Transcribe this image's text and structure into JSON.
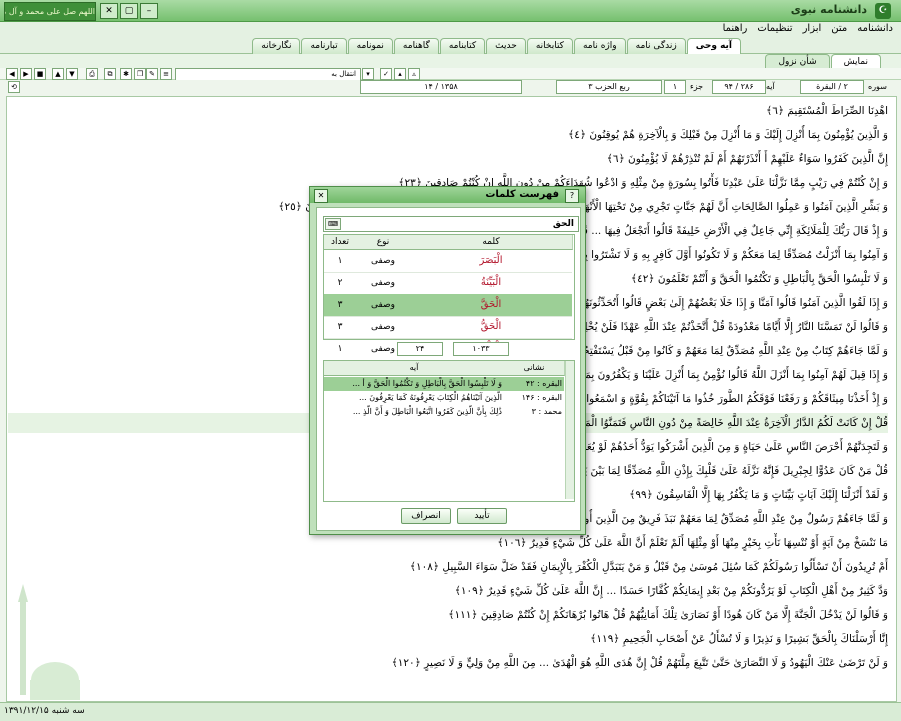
{
  "window": {
    "title": "دانشنامه نبوی",
    "calligraphy": "اللهم صل علی محمد و آل محمد"
  },
  "menu": [
    "دانشنامه",
    "متن",
    "ابزار",
    "تنظیمات",
    "راهنما"
  ],
  "tabs": [
    {
      "label": "آیه وحی",
      "active": true
    },
    {
      "label": "زندگی نامه",
      "active": false
    },
    {
      "label": "واژه نامه",
      "active": false
    },
    {
      "label": "کتابخانه",
      "active": false
    },
    {
      "label": "حدیث",
      "active": false
    },
    {
      "label": "کتابنامه",
      "active": false
    },
    {
      "label": "گاهنامه",
      "active": false
    },
    {
      "label": "نمونامه",
      "active": false
    },
    {
      "label": "تبارنامه",
      "active": false
    },
    {
      "label": "نگارخانه",
      "active": false
    }
  ],
  "subtabs": [
    {
      "label": "نمایش",
      "active": true
    },
    {
      "label": "شأن نزول",
      "active": false
    }
  ],
  "toolbar": {
    "jump_placeholder": "انتقال به"
  },
  "nav": {
    "surah_label": "سوره",
    "surah_value": "۲ / البقرة",
    "ayah_label": "آیه",
    "ayah_value": "۲۸۶ / ۹۴",
    "juz_label": "جزء",
    "juz_value": "۱",
    "hizb_value": "ربع الحزب ۳",
    "page_value": "۱۳۵۸ / ۱۴"
  },
  "verses": [
    {
      "text": "اهْدِنَا الصِّرَاطَ الْمُسْتَقِيمَ ﴿٦﴾"
    },
    {
      "text": "وَ الَّذِينَ يُؤْمِنُونَ بِمَا أُنْزِلَ إِلَيْكَ وَ مَا أُنْزِلَ مِنْ قَبْلِكَ وَ بِالْآخِرَةِ هُمْ يُوقِنُونَ ﴿٤﴾"
    },
    {
      "text": "إِنَّ الَّذِينَ كَفَرُوا سَوَاءٌ عَلَيْهِمْ أَ أَنْذَرْتَهُمْ أَمْ لَمْ تُنْذِرْهُمْ لَا يُؤْمِنُونَ ﴿٦﴾"
    },
    {
      "text": "وَ إِنْ كُنْتُمْ فِي رَيْبٍ مِمَّا نَزَّلْنَا عَلَىٰ عَبْدِنَا فَأْتُوا بِسُورَةٍ مِنْ مِثْلِهِ وَ ادْعُوا شُهَدَاءَكُمْ مِنْ دُونِ اللَّهِ إِنْ كُنْتُمْ صَادِقِينَ ﴿٢٣﴾"
    },
    {
      "text": "وَ بَشِّرِ الَّذِينَ آمَنُوا وَ عَمِلُوا الصَّالِحَاتِ أَنَّ لَهُمْ جَنَّاتٍ تَجْرِي مِنْ تَحْتِهَا الْأَنْهَارُ ... وَ أُتُوا بِهِ مُتَشَابِهًا وَ لَهُمْ فِيهَا أَزْوَاجٌ مُطَهَّرَةٌ وَ هُمْ فِيهَا خَالِدُونَ ﴿٢٥﴾"
    },
    {
      "text": "وَ إِذْ قَالَ رَبُّكَ لِلْمَلَائِكَةِ إِنِّي جَاعِلٌ فِي الْأَرْضِ خَلِيفَةً قَالُوا أَتَجْعَلُ فِيهَا ... قَالَ إِنِّي أَعْلَمُ مَا لَا تَعْلَمُونَ ﴿٣٠﴾"
    },
    {
      "text": "وَ آمِنُوا بِمَا أَنْزَلْتُ مُصَدِّقًا لِمَا مَعَكُمْ وَ لَا تَكُونُوا أَوَّلَ كَافِرٍ بِهِ وَ لَا تَشْتَرُوا بِآيَاتِي ثَمَنًا قَلِيلًا وَ إِيَّايَ فَاتَّقُونِ ﴿٤١﴾"
    },
    {
      "text": "وَ لَا تَلْبِسُوا الْحَقَّ بِالْبَاطِلِ وَ تَكْتُمُوا الْحَقَّ وَ أَنْتُمْ تَعْلَمُونَ ﴿٤٢﴾"
    },
    {
      "text": "وَ إِذَا لَقُوا الَّذِينَ آمَنُوا قَالُوا آمَنَّا وَ إِذَا خَلَا بَعْضُهُمْ إِلَىٰ بَعْضٍ قَالُوا أَتُحَدِّثُونَهُمْ ... ﴿٧٦﴾"
    },
    {
      "text": "وَ قَالُوا لَنْ تَمَسَّنَا النَّارُ إِلَّا أَيَّامًا مَعْدُودَةً قُلْ أَتَّخَذْتُمْ عِنْدَ اللَّهِ عَهْدًا فَلَنْ يُخْلِفَ اللَّهُ عَهْدَهُ ... ﴿٨٠﴾"
    },
    {
      "text": "وَ لَمَّا جَاءَهُمْ كِتَابٌ مِنْ عِنْدِ اللَّهِ مُصَدِّقٌ لِمَا مَعَهُمْ وَ كَانُوا مِنْ قَبْلُ يَسْتَفْتِحُونَ ... عَلَى الْكَافِرِينَ ﴿٨٩﴾"
    },
    {
      "text": "وَ إِذَا قِيلَ لَهُمْ آمِنُوا بِمَا أَنْزَلَ اللَّهُ قَالُوا نُؤْمِنُ بِمَا أُنْزِلَ عَلَيْنَا وَ يَكْفُرُونَ بِمَا وَرَاءَهُ ... إِنْ كُنْتُمْ مُؤْمِنِينَ ﴿٩١﴾"
    },
    {
      "text": "وَ إِذْ أَخَذْنَا مِيثَاقَكُمْ وَ رَفَعْنَا فَوْقَكُمُ الطُّورَ خُذُوا مَا آتَيْنَاكُمْ بِقُوَّةٍ وَ اسْمَعُوا ... بِئْسَمَا يَأْمُرُكُمْ بِهِ إِيمَانُكُمْ إِنْ كُنْتُمْ مُؤْمِنِينَ ﴿٩٣﴾"
    },
    {
      "text": "قُلْ إِنْ كَانَتْ لَكُمُ الدَّارُ الْآخِرَةُ عِنْدَ اللَّهِ خَالِصَةً مِنْ دُونِ النَّاسِ فَتَمَنَّوُا الْمَوْتَ إِنْ كُنْتُمْ صَادِقِينَ ﴿٩٤﴾",
      "highlight": true
    },
    {
      "text": "وَ لَتَجِدَنَّهُمْ أَحْرَصَ النَّاسِ عَلَىٰ حَيَاةٍ وَ مِنَ الَّذِينَ أَشْرَكُوا يَوَدُّ أَحَدُهُمْ لَوْ يُعَمَّرُ أَلْفَ سَنَةٍ ... بِمَا يَعْمَلُونَ ﴿٩٦﴾"
    },
    {
      "text": "قُلْ مَنْ كَانَ عَدُوًّا لِجِبْرِيلَ فَإِنَّهُ نَزَّلَهُ عَلَىٰ قَلْبِكَ بِإِذْنِ اللَّهِ مُصَدِّقًا لِمَا بَيْنَ يَدَيْهِ ... ﴿٩٧﴾"
    },
    {
      "text": "وَ لَقَدْ أَنْزَلْنَا إِلَيْكَ آيَاتٍ بَيِّنَاتٍ وَ مَا يَكْفُرُ بِهَا إِلَّا الْفَاسِقُونَ ﴿٩٩﴾"
    },
    {
      "text": "وَ لَمَّا جَاءَهُمْ رَسُولٌ مِنْ عِنْدِ اللَّهِ مُصَدِّقٌ لِمَا مَعَهُمْ نَبَذَ فَرِيقٌ مِنَ الَّذِينَ أُوتُوا الْكِتَابَ ... ﴿١٠١﴾"
    },
    {
      "text": "مَا نَنْسَخْ مِنْ آيَةٍ أَوْ نُنْسِهَا نَأْتِ بِخَيْرٍ مِنْهَا أَوْ مِثْلِهَا أَلَمْ تَعْلَمْ أَنَّ اللَّهَ عَلَىٰ كُلِّ شَيْءٍ قَدِيرٌ ﴿١٠٦﴾"
    },
    {
      "text": "أَمْ تُرِيدُونَ أَنْ تَسْأَلُوا رَسُولَكُمْ كَمَا سُئِلَ مُوسَىٰ مِنْ قَبْلُ وَ مَنْ يَتَبَدَّلِ الْكُفْرَ بِالْإِيمَانِ فَقَدْ ضَلَّ سَوَاءَ السَّبِيلِ ﴿١٠٨﴾"
    },
    {
      "text": "وَدَّ كَثِيرٌ مِنْ أَهْلِ الْكِتَابِ لَوْ يَرُدُّونَكُمْ مِنْ بَعْدِ إِيمَانِكُمْ كُفَّارًا حَسَدًا ... إِنَّ اللَّهَ عَلَىٰ كُلِّ شَيْءٍ قَدِيرٌ ﴿١٠٩﴾"
    },
    {
      "text": "وَ قَالُوا لَنْ يَدْخُلَ الْجَنَّةَ إِلَّا مَنْ كَانَ هُودًا أَوْ نَصَارَىٰ تِلْكَ أَمَانِيُّهُمْ قُلْ هَاتُوا بُرْهَانَكُمْ إِنْ كُنْتُمْ صَادِقِينَ ﴿١١١﴾"
    },
    {
      "text": "إِنَّا أَرْسَلْنَاكَ بِالْحَقِّ بَشِيرًا وَ نَذِيرًا وَ لَا تُسْأَلُ عَنْ أَصْحَابِ الْجَحِيمِ ﴿١١٩﴾"
    },
    {
      "text": "وَ لَنْ تَرْضَىٰ عَنْكَ الْيَهُودُ وَ لَا النَّصَارَىٰ حَتَّىٰ تَتَّبِعَ مِلَّتَهُمْ قُلْ إِنَّ هُدَى اللَّهِ هُوَ الْهُدَىٰ ... مِنَ اللَّهِ مِنْ وَلِيٍّ وَ لَا نَصِيرٍ ﴿١٢٠﴾"
    }
  ],
  "status": {
    "date": "سه شنبه ۱۳۹۱/۱۲/۱۵"
  },
  "dialog": {
    "title": "فهرست کلمات",
    "search_value": "الحق",
    "columns": {
      "word": "کلمه",
      "type": "نوع",
      "count": "تعداد"
    },
    "words": [
      {
        "word": "الْبَصَرَ",
        "type": "وصفی",
        "count": "۱",
        "selected": false
      },
      {
        "word": "الْبَيِّنَةُ",
        "type": "وصفی",
        "count": "۲",
        "selected": false
      },
      {
        "word": "الْحَقَّ",
        "type": "وصفی",
        "count": "۳",
        "selected": true
      },
      {
        "word": "الْحَقُّ",
        "type": "وصفی",
        "count": "۳",
        "selected": false
      },
      {
        "word": "الْعِلْمُ",
        "type": "وصفی",
        "count": "۱",
        "selected": false
      }
    ],
    "total_count": "۱۰۳۳",
    "found_count": "۲۴",
    "vcolumns": {
      "address": "نشانی",
      "ayah": "آیه"
    },
    "verses": [
      {
        "address": "البقره : ۴۲",
        "text": "وَ لَا تَلْبِسُوا الْحَقَّ بِالْبَاطِلِ وَ تَكْتُمُوا الْحَقَّ وَ أ ...",
        "selected": true
      },
      {
        "address": "البقره : ۱۴۶",
        "text": "الَّذِينَ آتَيْنَاهُمُ الْكِتَابَ يَعْرِفُونَهُ كَمَا يَعْرِفُونَ ...",
        "selected": false
      },
      {
        "address": "محمد : ۳",
        "text": "ذَٰلِكَ بِأَنَّ الَّذِينَ كَفَرُوا اتَّبَعُوا الْبَاطِلَ وَ أَنَّ الَّذِ ...",
        "selected": false
      }
    ],
    "ok_label": "تأیید",
    "cancel_label": "انصراف"
  }
}
